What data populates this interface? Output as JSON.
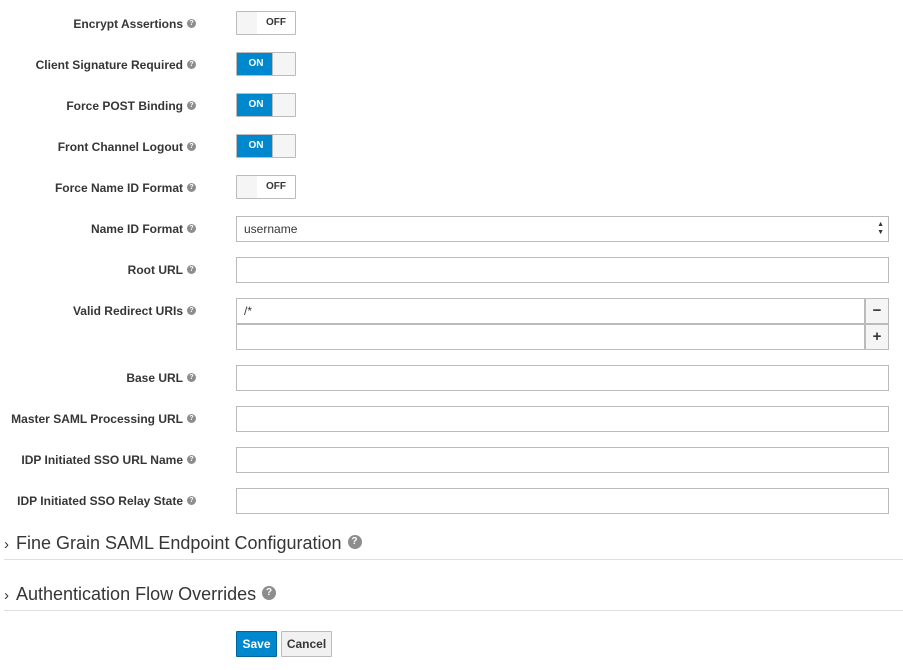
{
  "help_icon": "?",
  "fields": {
    "encrypt_assertions": {
      "label": "Encrypt Assertions",
      "state": "OFF"
    },
    "client_signature_required": {
      "label": "Client Signature Required",
      "state": "ON"
    },
    "force_post_binding": {
      "label": "Force POST Binding",
      "state": "ON"
    },
    "front_channel_logout": {
      "label": "Front Channel Logout",
      "state": "ON"
    },
    "force_name_id_format": {
      "label": "Force Name ID Format",
      "state": "OFF"
    },
    "name_id_format": {
      "label": "Name ID Format",
      "value": "username"
    },
    "root_url": {
      "label": "Root URL",
      "value": ""
    },
    "valid_redirect_uris": {
      "label": "Valid Redirect URIs",
      "values": [
        "/*",
        ""
      ],
      "remove_label": "−",
      "add_label": "+"
    },
    "base_url": {
      "label": "Base URL",
      "value": ""
    },
    "master_saml_processing_url": {
      "label": "Master SAML Processing URL",
      "value": ""
    },
    "idp_initiated_sso_url_name": {
      "label": "IDP Initiated SSO URL Name",
      "value": ""
    },
    "idp_initiated_sso_relay_state": {
      "label": "IDP Initiated SSO Relay State",
      "value": ""
    }
  },
  "sections": {
    "fine_grain": {
      "chevron": "›",
      "title": "Fine Grain SAML Endpoint Configuration"
    },
    "auth_flow": {
      "chevron": "›",
      "title": "Authentication Flow Overrides"
    }
  },
  "actions": {
    "save": "Save",
    "cancel": "Cancel"
  },
  "colors": {
    "primary": "#0088ce",
    "toggle_on": "#0088ce"
  }
}
